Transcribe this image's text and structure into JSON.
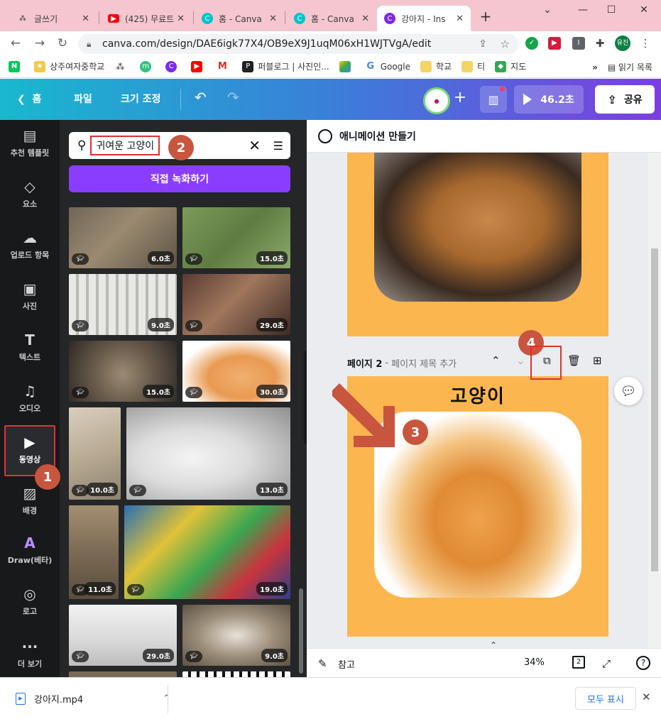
{
  "browser": {
    "tabs": [
      {
        "label": "글쓰기",
        "fav": "#333333",
        "glyph": "⁂"
      },
      {
        "label": "(425) 무료트",
        "fav": "#ff0000",
        "glyph": "▶"
      },
      {
        "label": "홈 - Canva",
        "fav": "#00c4cc",
        "glyph": "C"
      },
      {
        "label": "홈 - Canva",
        "fav": "#00c4cc",
        "glyph": "C"
      },
      {
        "label": "강아지 - Ins",
        "fav": "#7d2ae8",
        "glyph": "C"
      }
    ],
    "url": "canva.com/design/DAE6igk77X4/OB9eX9J1uqM06xH1WJTVgA/edit",
    "profile_label": "유진",
    "bookmarks": [
      "상주여자중학교",
      "퍼블로그 | 사진인...",
      "Google",
      "학교",
      "티",
      "지도"
    ],
    "reading_list": "읽기 목록"
  },
  "canva_bar": {
    "home": "홈",
    "file": "파일",
    "resize": "크기 조정",
    "duration": "46.2초",
    "share": "공유"
  },
  "rail": [
    {
      "label": "추천 템플릿",
      "icon": "template-icon",
      "glyph": "▤"
    },
    {
      "label": "요소",
      "icon": "elements-icon",
      "glyph": "◇"
    },
    {
      "label": "업로드 항목",
      "icon": "upload-icon",
      "glyph": "☁"
    },
    {
      "label": "사진",
      "icon": "photo-icon",
      "glyph": "▣"
    },
    {
      "label": "텍스트",
      "icon": "text-icon",
      "glyph": "T"
    },
    {
      "label": "오디오",
      "icon": "audio-icon",
      "glyph": "♫"
    },
    {
      "label": "동영상",
      "icon": "video-icon",
      "glyph": "▶"
    },
    {
      "label": "배경",
      "icon": "background-icon",
      "glyph": "▨"
    },
    {
      "label": "Draw(베타)",
      "icon": "draw-icon",
      "glyph": "A"
    },
    {
      "label": "로고",
      "icon": "logo-icon",
      "glyph": "◎"
    },
    {
      "label": "더 보기",
      "icon": "more-icon",
      "glyph": "···"
    }
  ],
  "panel": {
    "search_query": "귀여운 고양이",
    "record_button": "직접 녹화하기",
    "videos": [
      "6.0초",
      "15.0초",
      "9.0초",
      "29.0초",
      "15.0초",
      "30.0초",
      "10.0초",
      "13.0초",
      "11.0초",
      "19.0초",
      "29.0초",
      "9.0초"
    ]
  },
  "editor": {
    "animate": "애니메이션 만들기",
    "page_label": "페이지 2",
    "page_sep": "-",
    "page_title_placeholder": "페이지 제목 추가",
    "page_heading": "고양이",
    "notes": "참고",
    "zoom": "34%",
    "page_count": "2"
  },
  "badges": [
    "1",
    "2",
    "3",
    "4"
  ],
  "download": {
    "file": "강아지.mp4",
    "show_all": "모두 표시"
  }
}
